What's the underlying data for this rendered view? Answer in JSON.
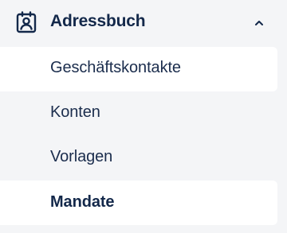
{
  "section": {
    "title": "Adressbuch",
    "icon": "address-book-icon",
    "collapse_icon": "chevron-up-icon"
  },
  "items": [
    {
      "label": "Geschäftskontakte"
    },
    {
      "label": "Konten"
    },
    {
      "label": "Vorlagen"
    },
    {
      "label": "Mandate",
      "active": true
    }
  ],
  "colors": {
    "text": "#13284a",
    "background": "#f4f5f7",
    "item_background": "#ffffff"
  }
}
